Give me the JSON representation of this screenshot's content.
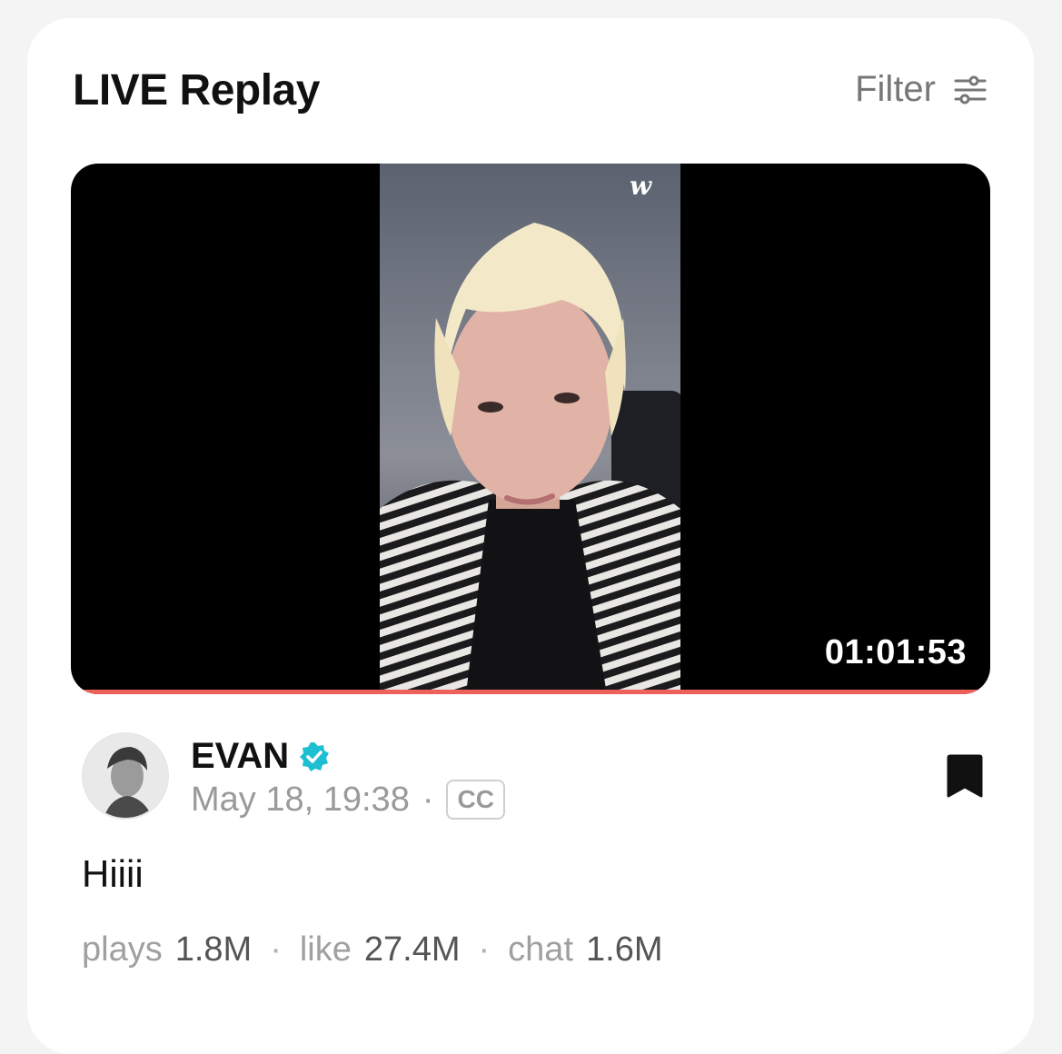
{
  "header": {
    "title": "LIVE Replay",
    "filter_label": "Filter",
    "filter_icon": "sliders-icon"
  },
  "video": {
    "duration": "01:01:53",
    "watermark_icon": "weverse-logo-icon",
    "progress": 1.0,
    "progress_color": "#f0605a"
  },
  "post": {
    "author": "EVAN",
    "verified_icon": "verified-badge-icon",
    "verified_color": "#1ebfd3",
    "date": "May 18, 19:38",
    "separator": "·",
    "cc_label": "CC",
    "bookmark_icon": "bookmark-icon",
    "text": "Hiiii"
  },
  "stats": {
    "plays_label": "plays",
    "plays_value": "1.8M",
    "like_label": "like",
    "like_value": "27.4M",
    "chat_label": "chat",
    "chat_value": "1.6M",
    "separator": "·"
  }
}
